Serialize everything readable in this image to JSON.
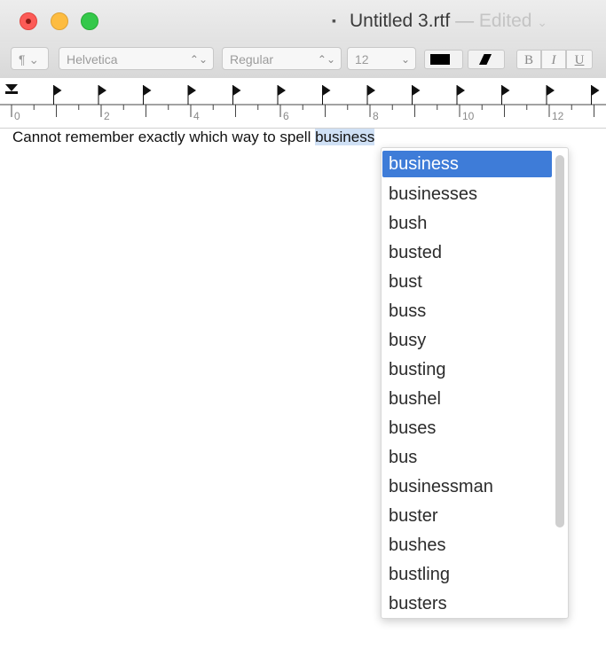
{
  "window": {
    "title": "Untitled 3.rtf",
    "separator": "—",
    "status": "Edited",
    "status_chevron": "⌄"
  },
  "toolbar": {
    "paragraph_style": "¶ ⌄",
    "font_family": "Helvetica",
    "font_style": "Regular",
    "font_size": "12",
    "text_color": "#000000",
    "bold_label": "B",
    "italic_label": "I",
    "underline_label": "U",
    "stepper_glyph": "⌃⌄",
    "dropdown_glyph": "⌄"
  },
  "ruler": {
    "labels": [
      "0",
      "2",
      "4",
      "6",
      "8",
      "10",
      "12"
    ]
  },
  "document": {
    "text_before": "Cannot remember exactly which way to spell ",
    "highlighted_word": "business"
  },
  "completions": {
    "selected_index": 0,
    "items": [
      "business",
      "businesses",
      "bush",
      "busted",
      "bust",
      "buss",
      "busy",
      "busting",
      "bushel",
      "buses",
      "bus",
      "businessman",
      "buster",
      "bushes",
      "bustling",
      "busters"
    ]
  },
  "colors": {
    "selection": "#3e7cd8",
    "text_highlight": "#cfe0f5",
    "close": "#fc5b57",
    "minimize": "#fdbc40",
    "maximize": "#34c84a"
  }
}
